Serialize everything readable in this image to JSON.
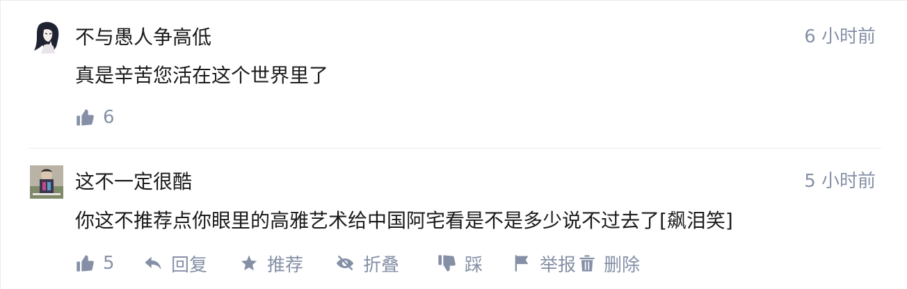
{
  "comments": [
    {
      "author": "不与愚人争高低",
      "time": "6 小时前",
      "content": "真是辛苦您活在这个世界里了",
      "likes": "6",
      "avatar_icon": "anime-girl-avatar"
    },
    {
      "author": "这不一定很酷",
      "time": "5 小时前",
      "content": "你这不推荐点你眼里的高雅艺术给中国阿宅看是不是多少说不过去了[飙泪笑]",
      "likes": "5",
      "avatar_icon": "photo-avatar",
      "actions": {
        "reply": "回复",
        "recommend": "推荐",
        "fold": "折叠",
        "dislike": "踩",
        "report": "举报",
        "delete": "删除"
      }
    }
  ],
  "colors": {
    "text": "#1a1a1a",
    "meta": "#8590a6",
    "divider": "#ebebeb"
  }
}
